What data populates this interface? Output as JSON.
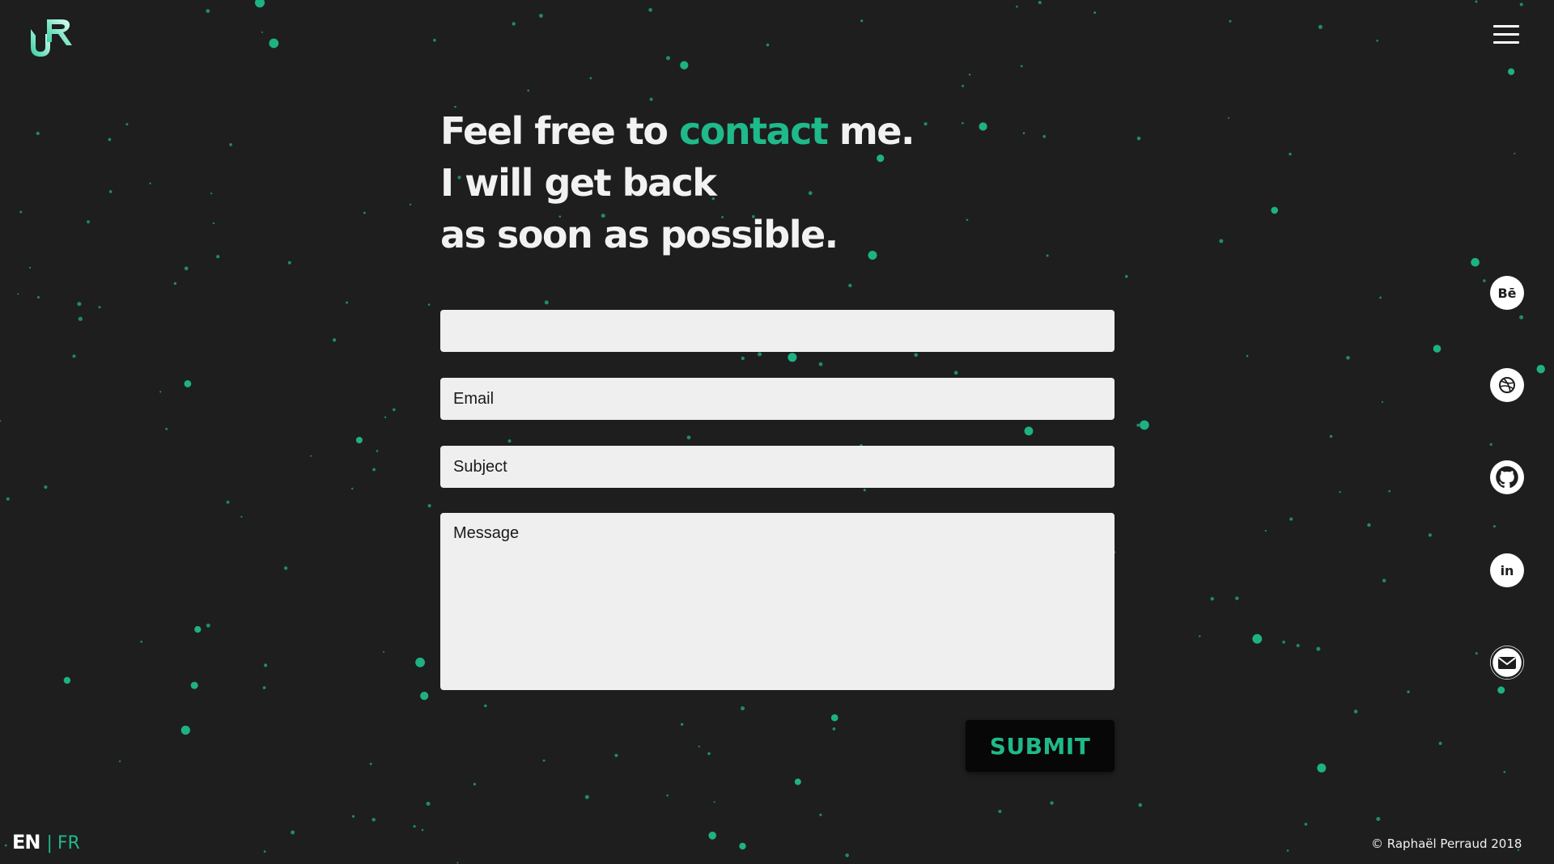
{
  "colors": {
    "background": "#1e1e1e",
    "accent": "#1fb98a",
    "field_background": "#efefef",
    "button_background": "#070707",
    "text": "#ffffff"
  },
  "header": {
    "logo_icon": "logo-monogram-icon",
    "menu_icon": "hamburger-menu-icon"
  },
  "headline": {
    "line1_before": "Feel free to ",
    "line1_accent": "contact",
    "line1_after": " me.",
    "line2": "I will get back",
    "line3": "as soon as possible."
  },
  "form": {
    "name_value": "",
    "name_placeholder": "",
    "email_placeholder": "Email",
    "subject_placeholder": "Subject",
    "message_placeholder": "Message",
    "submit_label": "SUBMIT"
  },
  "social": {
    "items": [
      {
        "name": "behance",
        "icon": "behance-icon",
        "glyph": "Bē"
      },
      {
        "name": "dribbble",
        "icon": "dribbble-icon"
      },
      {
        "name": "github",
        "icon": "github-icon"
      },
      {
        "name": "linkedin",
        "icon": "linkedin-icon",
        "glyph": "in"
      },
      {
        "name": "mail",
        "icon": "mail-icon"
      }
    ]
  },
  "footer": {
    "lang_en": "EN",
    "lang_separator": "|",
    "lang_fr": "FR",
    "copyright": "© Raphaël Perraud 2018"
  }
}
